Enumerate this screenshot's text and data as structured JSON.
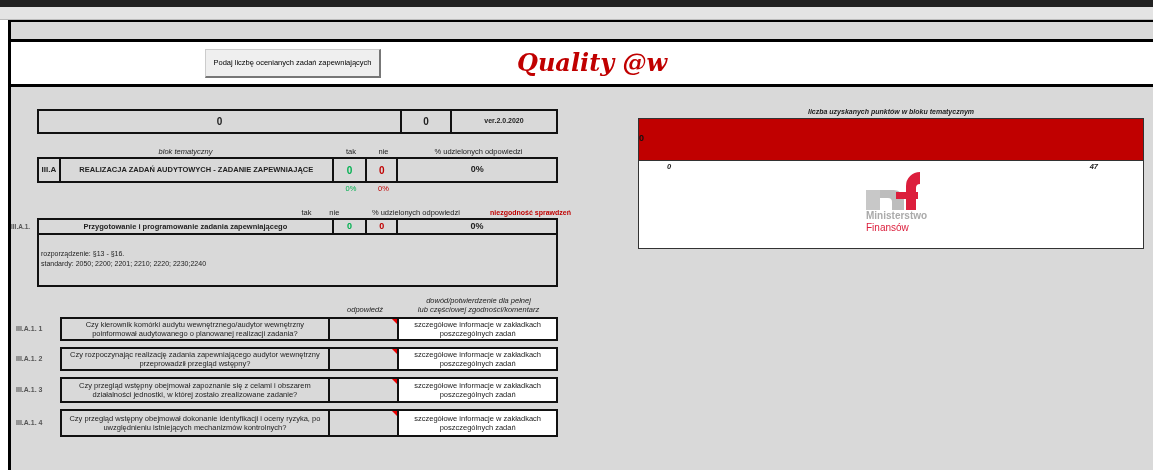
{
  "toolbar": {
    "button": "Podaj liczbę ocenianych zadań zapewniających",
    "brand": "Quality @w"
  },
  "summary": {
    "title": "0",
    "count": "0",
    "version": "ver.2.0.2020"
  },
  "block": {
    "caption": "blok tematyczny",
    "col_yes": "tak",
    "col_no": "nie",
    "col_pct": "% udzielonych odpowiedzi",
    "code": "III.A",
    "title": "REALIZACJA ZADAŃ AUDYTOWYCH - ZADANIE ZAPEWNIAJĄCE",
    "yes": "0",
    "no": "0",
    "pct": "0%",
    "yes_pct": "0%",
    "no_pct": "0%"
  },
  "section": {
    "col_yes": "tak",
    "col_no": "nie",
    "col_pct": "% udzielonych odpowiedzi",
    "warning": "niezgodność sprawdzeń",
    "code": "III.A.1.",
    "title": "Przygotowanie i programowanie zadania zapewniającego",
    "yes": "0",
    "no": "0",
    "pct": "0%",
    "notes": [
      "rozporządzenie: §13 - §16.",
      "standardy: 2050; 2200; 2201; 2210; 2220; 2230;2240"
    ]
  },
  "questions_header": {
    "answer": "odpowiedź",
    "evidence": [
      "dowód/potwierdzenie dla pełnej",
      "lub częściowej zgodności/komentarz"
    ]
  },
  "questions": [
    {
      "code": "III.A.1. 1",
      "text": "Czy kierownik komórki audytu wewnętrznego/audytor wewnętrzny poinformował audytowanego o planowanej realizacji zadania?",
      "comment": "szczegółowe informacje w zakładkach poszczególnych zadań"
    },
    {
      "code": "III.A.1. 2",
      "text": "Czy rozpoczynając realizację zadania zapewniającego audytor wewnętrzny przeprowadził przegląd wstępny?",
      "comment": "szczegółowe informacje w zakładkach poszczególnych zadań"
    },
    {
      "code": "III.A.1. 3",
      "text": "Czy przegląd wstępny obejmował zapoznanie się z celami i obszarem działalności jednostki, w której zostało zrealizowane zadanie?",
      "comment": "szczegółowe informacje w zakładkach poszczególnych zadań"
    },
    {
      "code": "III.A.1. 4",
      "text": "Czy przegląd wstępny obejmował dokonanie identyfikacji i oceny ryzyka, po uwzględnieniu istniejących mechanizmów kontrolnych?",
      "comment": "szczegółowe informacje w zakładkach poszczególnych zadań"
    }
  ],
  "score_panel": {
    "caption": "liczba uzyskanych punktów w bloku tematycznym",
    "value": "0",
    "axis_min": "0",
    "axis_max": "47",
    "logo_lines": [
      "Ministerstwo",
      "Finansów"
    ]
  }
}
